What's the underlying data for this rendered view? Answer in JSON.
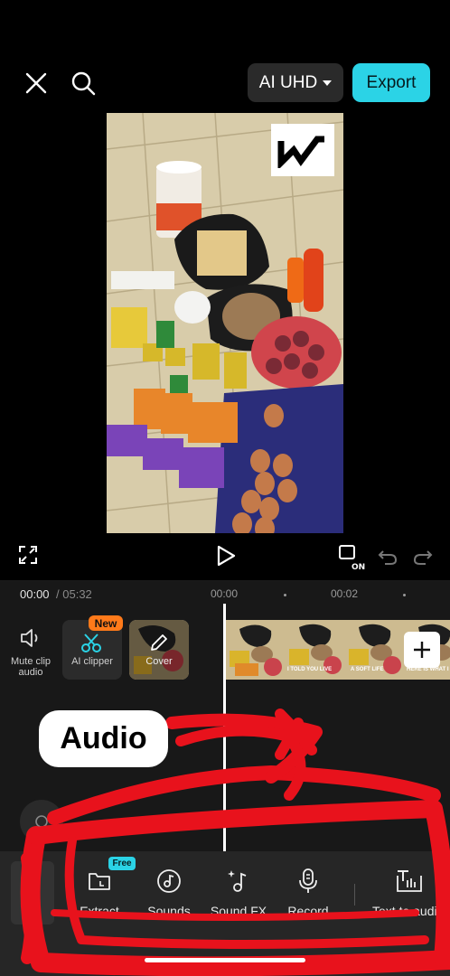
{
  "toolbar": {
    "quality_label": "AI UHD",
    "export_label": "Export"
  },
  "time": {
    "current": "00:00",
    "separator": "/",
    "duration": "05:32",
    "ruler": [
      "00:00",
      "00:02"
    ]
  },
  "left_tools": {
    "mute": "Mute clip audio",
    "ai_clipper": "AI clipper",
    "ai_clipper_badge": "New",
    "cover": "Cover"
  },
  "clip_captions": [
    "I TOLD YOU LIVE",
    "A SOFT LIFE",
    "HERE IS WHAT I"
  ],
  "annotation": {
    "audio_label": "Audio"
  },
  "bottom_tools": [
    {
      "label": "Extract",
      "icon": "folder-icon"
    },
    {
      "label": "Sounds",
      "icon": "music-disc-icon"
    },
    {
      "label": "Sound FX",
      "icon": "sound-fx-icon"
    },
    {
      "label": "Record",
      "icon": "microphone-icon"
    },
    {
      "label": "Text to audio",
      "icon": "text-to-audio-icon"
    }
  ],
  "badges": {
    "free": "Free"
  },
  "colors": {
    "accent": "#2bd3e6",
    "new_badge": "#ff7a1a",
    "scribble": "#e8121c"
  }
}
